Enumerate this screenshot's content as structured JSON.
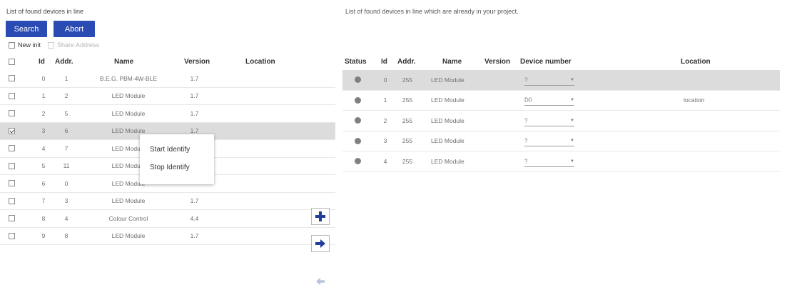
{
  "left_panel": {
    "title": "List of found devices in line",
    "search_label": "Search",
    "abort_label": "Abort",
    "new_init_label": "New init",
    "share_address_label": "Share Address",
    "columns": [
      "Id",
      "Addr.",
      "Name",
      "Version",
      "Location"
    ],
    "rows": [
      {
        "id": "0",
        "addr": "1",
        "name": "B.E.G. PBM-4W-BLE",
        "version": "1.7",
        "location": "",
        "checked": false
      },
      {
        "id": "1",
        "addr": "2",
        "name": "LED Module",
        "version": "1.7",
        "location": "",
        "checked": false
      },
      {
        "id": "2",
        "addr": "5",
        "name": "LED Module",
        "version": "1.7",
        "location": "",
        "checked": false
      },
      {
        "id": "3",
        "addr": "6",
        "name": "LED Module",
        "version": "1.7",
        "location": "",
        "checked": true
      },
      {
        "id": "4",
        "addr": "7",
        "name": "LED Module",
        "version": "",
        "location": "",
        "checked": false
      },
      {
        "id": "5",
        "addr": "11",
        "name": "LED Module",
        "version": "",
        "location": "",
        "checked": false
      },
      {
        "id": "6",
        "addr": "0",
        "name": "LED Module",
        "version": "",
        "location": "",
        "checked": false
      },
      {
        "id": "7",
        "addr": "3",
        "name": "LED Module",
        "version": "1.7",
        "location": "",
        "checked": false
      },
      {
        "id": "8",
        "addr": "4",
        "name": "Colour Control",
        "version": "4.4",
        "location": "",
        "checked": false
      },
      {
        "id": "9",
        "addr": "8",
        "name": "LED Module",
        "version": "1.7",
        "location": "",
        "checked": false
      }
    ]
  },
  "context_menu": {
    "items": [
      "Start Identify",
      "Stop Identify"
    ]
  },
  "middle_buttons": {
    "add_icon": "plus-icon",
    "transfer_icon": "arrow-right-icon",
    "back_icon": "arrow-left-icon"
  },
  "right_panel": {
    "title": "List of found devices in line which are already in your project.",
    "columns": [
      "Status",
      "Id",
      "Addr.",
      "Name",
      "Version",
      "Device number",
      "Location"
    ],
    "rows": [
      {
        "id": "0",
        "addr": "255",
        "name": "LED Module",
        "version": "",
        "device_number": "?",
        "location": ""
      },
      {
        "id": "1",
        "addr": "255",
        "name": "LED Module",
        "version": "",
        "device_number": "D0",
        "location": "location"
      },
      {
        "id": "2",
        "addr": "255",
        "name": "LED Module",
        "version": "",
        "device_number": "?",
        "location": ""
      },
      {
        "id": "3",
        "addr": "255",
        "name": "LED Module",
        "version": "",
        "device_number": "?",
        "location": ""
      },
      {
        "id": "4",
        "addr": "255",
        "name": "LED Module",
        "version": "",
        "device_number": "?",
        "location": ""
      }
    ]
  },
  "colors": {
    "primary_button": "#2a4bb3",
    "selected_row": "#dcdcdc",
    "status_dot": "#808080",
    "arrow_icon": "#1f3f99"
  }
}
